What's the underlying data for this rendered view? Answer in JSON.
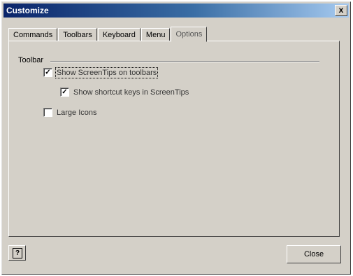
{
  "window": {
    "title": "Customize",
    "close_glyph": "x",
    "accent_title_color": "#0a246a"
  },
  "tabs": [
    {
      "label": "Commands",
      "active": false
    },
    {
      "label": "Toolbars",
      "active": false
    },
    {
      "label": "Keyboard",
      "active": false
    },
    {
      "label": "Menu",
      "active": false
    },
    {
      "label": "Options",
      "active": true
    }
  ],
  "options": {
    "group_label": "Toolbar",
    "checkboxes": [
      {
        "label": "Show ScreenTips on toolbars",
        "checked": true
      },
      {
        "label": "Show shortcut keys in ScreenTips",
        "checked": true
      },
      {
        "label": "Large Icons",
        "checked": false
      }
    ]
  },
  "footer": {
    "help_icon": "help-icon",
    "help_glyph": "?",
    "close_label": "Close"
  }
}
